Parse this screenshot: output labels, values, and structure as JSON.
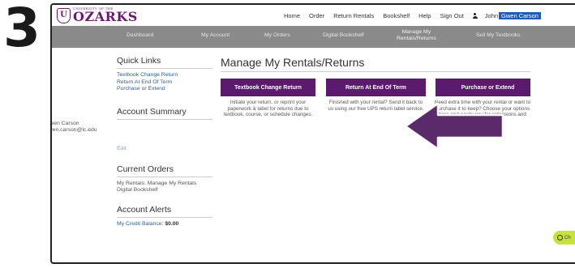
{
  "step": "3",
  "brand": {
    "small": "UNIVERSITY OF THE",
    "name": "OZARKS",
    "seal": "U"
  },
  "topnav": {
    "items": [
      "Home",
      "Order",
      "Return Rentals",
      "Bookshelf",
      "Help",
      "Sign Out"
    ],
    "user_first": "John",
    "user_name": "Gwen Carson"
  },
  "subnav": {
    "items": [
      "Dashboard",
      "My Account",
      "My Orders",
      "Digital Bookshelf",
      "Manage My\nRentals/Returns",
      "Sell My Textbooks"
    ]
  },
  "sidebar": {
    "quick_links_title": "Quick Links",
    "quick_links": [
      "Textbook Change Return",
      "Return At End Of Term",
      "Purchase or Extend"
    ],
    "account_summary_title": "Account Summary",
    "account_name": "Gwen Carson",
    "account_email": "gwen.carson@lc.edu",
    "edit_label": "Edit",
    "current_orders_title": "Current Orders",
    "current_orders_text": "My Rentals: Manage My Rentals",
    "current_orders_text2": "Digital Bookshelf",
    "alerts_title": "Account Alerts",
    "credit_label": "My Credit Balance:",
    "credit_value": "$0.00"
  },
  "main": {
    "title": "Manage My Rentals/Returns",
    "buttons": [
      {
        "label": "Textbook Change Return",
        "desc": "Initiate your return, or reprint your paperwork & label for returns due to textbook, course, or schedule changes."
      },
      {
        "label": "Return At End Of Term",
        "desc": "Finished with your rental? Send it back to us using our free UPS return label service."
      },
      {
        "label": "Purchase or Extend",
        "desc": "Need extra time with your rental or want to purchase it to keep? Choose your options here and easily pay for extensions and purchases."
      }
    ]
  },
  "chat": {
    "label": "Ch"
  },
  "colors": {
    "brand": "#6b1b6e",
    "button": "#5a1a6e",
    "subnav": "#8a8a8a",
    "arrow": "#5a2a6a",
    "highlight": "#1f5bb8",
    "chat": "#c6e23d"
  }
}
